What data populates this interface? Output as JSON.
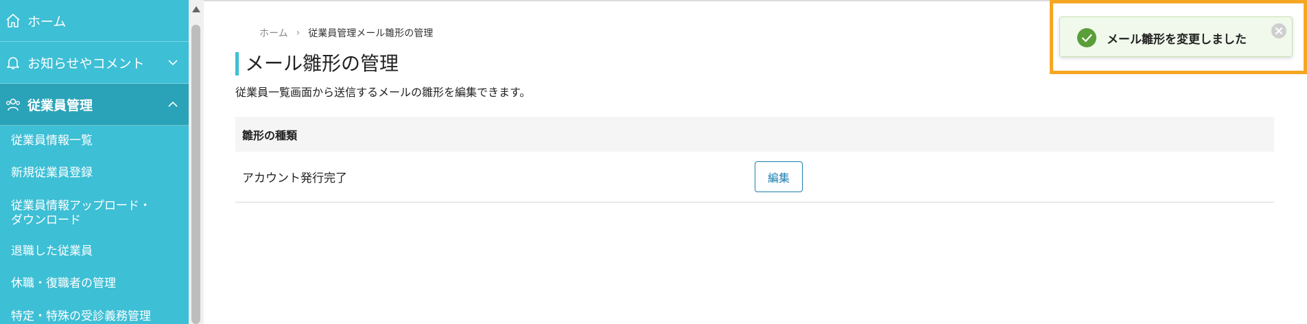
{
  "sidebar": {
    "items": [
      {
        "label": "ホーム",
        "icon": "home-icon"
      },
      {
        "label": "お知らせやコメント",
        "icon": "bell-icon"
      },
      {
        "label": "従業員管理",
        "icon": "people-icon"
      }
    ],
    "sub_items": [
      "従業員情報一覧",
      "新規従業員登録",
      "従業員情報アップロード・ダウンロード",
      "退職した従業員",
      "休職・復職者の管理",
      "特定・特殊の受診義務管理"
    ]
  },
  "breadcrumb": {
    "home": "ホーム",
    "separator": "›",
    "current": "従業員管理メール雛形の管理"
  },
  "page": {
    "title": "メール雛形の管理",
    "description": "従業員一覧画面から送信するメールの雛形を編集できます。"
  },
  "table": {
    "header": "雛形の種類",
    "rows": [
      {
        "label": "アカウント発行完了",
        "action": "編集"
      }
    ]
  },
  "toast": {
    "message": "メール雛形を変更しました",
    "status_color": "#5a9e3a"
  },
  "colors": {
    "sidebar": "#3dbfd5",
    "sidebar_active": "#2aa3b8",
    "accent": "#1b7fb0",
    "highlight": "#f5a623"
  }
}
